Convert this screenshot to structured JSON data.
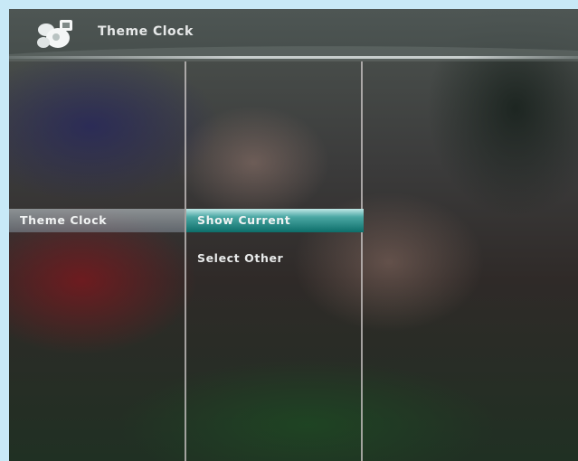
{
  "header": {
    "title": "Theme Clock",
    "logo_icon": "flower-logo-icon"
  },
  "columns": {
    "col1": {
      "items": [
        {
          "label": "Theme Clock",
          "state": "highlighted"
        }
      ]
    },
    "col2": {
      "items": [
        {
          "label": "Show Current",
          "state": "focused"
        },
        {
          "label": "Select Other",
          "state": "normal"
        }
      ]
    }
  },
  "colors": {
    "focus_highlight": "#0d6e6a",
    "title_text": "#e6e8e8",
    "outer_background": "#c8e9f7"
  }
}
